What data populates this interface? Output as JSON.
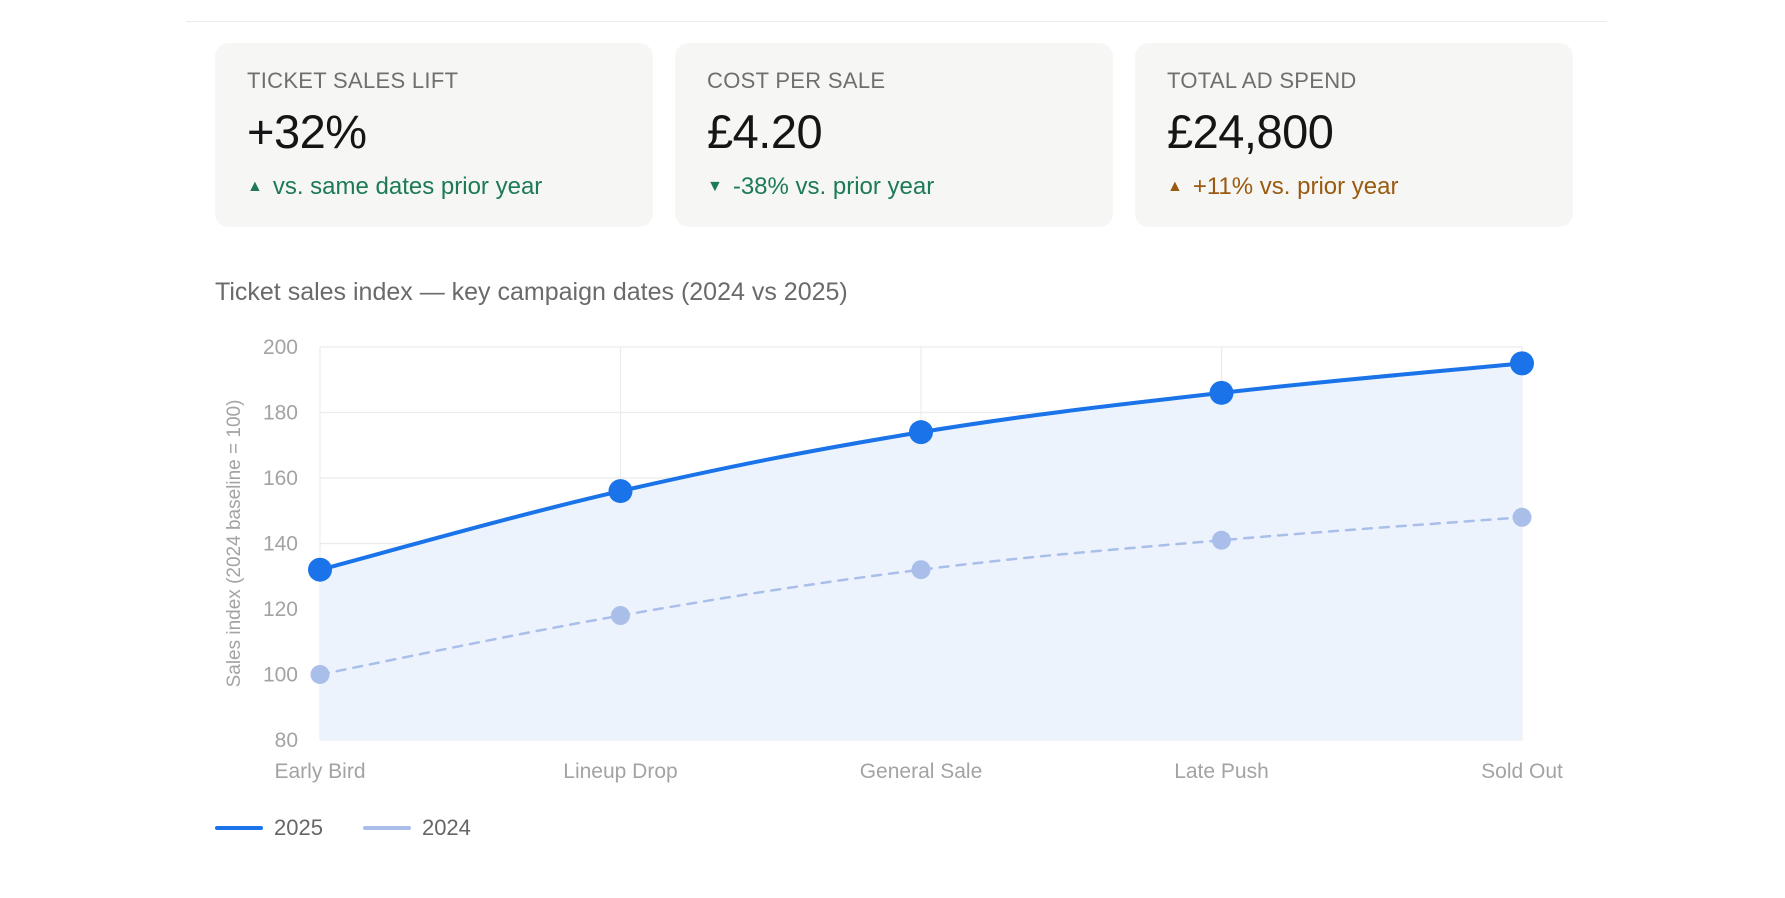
{
  "kpis": [
    {
      "label": "TICKET SALES LIFT",
      "value": "+32%",
      "arrow": "▲",
      "delta": "vs. same dates prior year",
      "tone": "good"
    },
    {
      "label": "COST PER SALE",
      "value": "£4.20",
      "arrow": "▼",
      "delta": "-38% vs. prior year",
      "tone": "good"
    },
    {
      "label": "TOTAL AD SPEND",
      "value": "£24,800",
      "arrow": "▲",
      "delta": "+11% vs. prior year",
      "tone": "warn"
    }
  ],
  "colors": {
    "series_2025": "#1a73e8",
    "series_2024": "#a9bfea",
    "area_fill": "#edf3fd",
    "good": "#1c7a55",
    "warn": "#9a5a10"
  },
  "chart_data": {
    "type": "line",
    "title": "Ticket sales index — key campaign dates (2024 vs 2025)",
    "xlabel": "",
    "ylabel": "Sales index (2024 baseline = 100)",
    "categories": [
      "Early Bird",
      "Lineup Drop",
      "General Sale",
      "Late Push",
      "Sold Out"
    ],
    "ylim": [
      80,
      200
    ],
    "yticks": [
      "200",
      "180",
      "160",
      "140",
      "120",
      "100",
      "80"
    ],
    "series": [
      {
        "name": "2025",
        "values": [
          132,
          156,
          174,
          186,
          195
        ],
        "style": "solid",
        "filled": true
      },
      {
        "name": "2024",
        "values": [
          100,
          118,
          132,
          141,
          148
        ],
        "style": "dashed",
        "filled": false
      }
    ],
    "grid": true,
    "legend": "bottom-left"
  }
}
